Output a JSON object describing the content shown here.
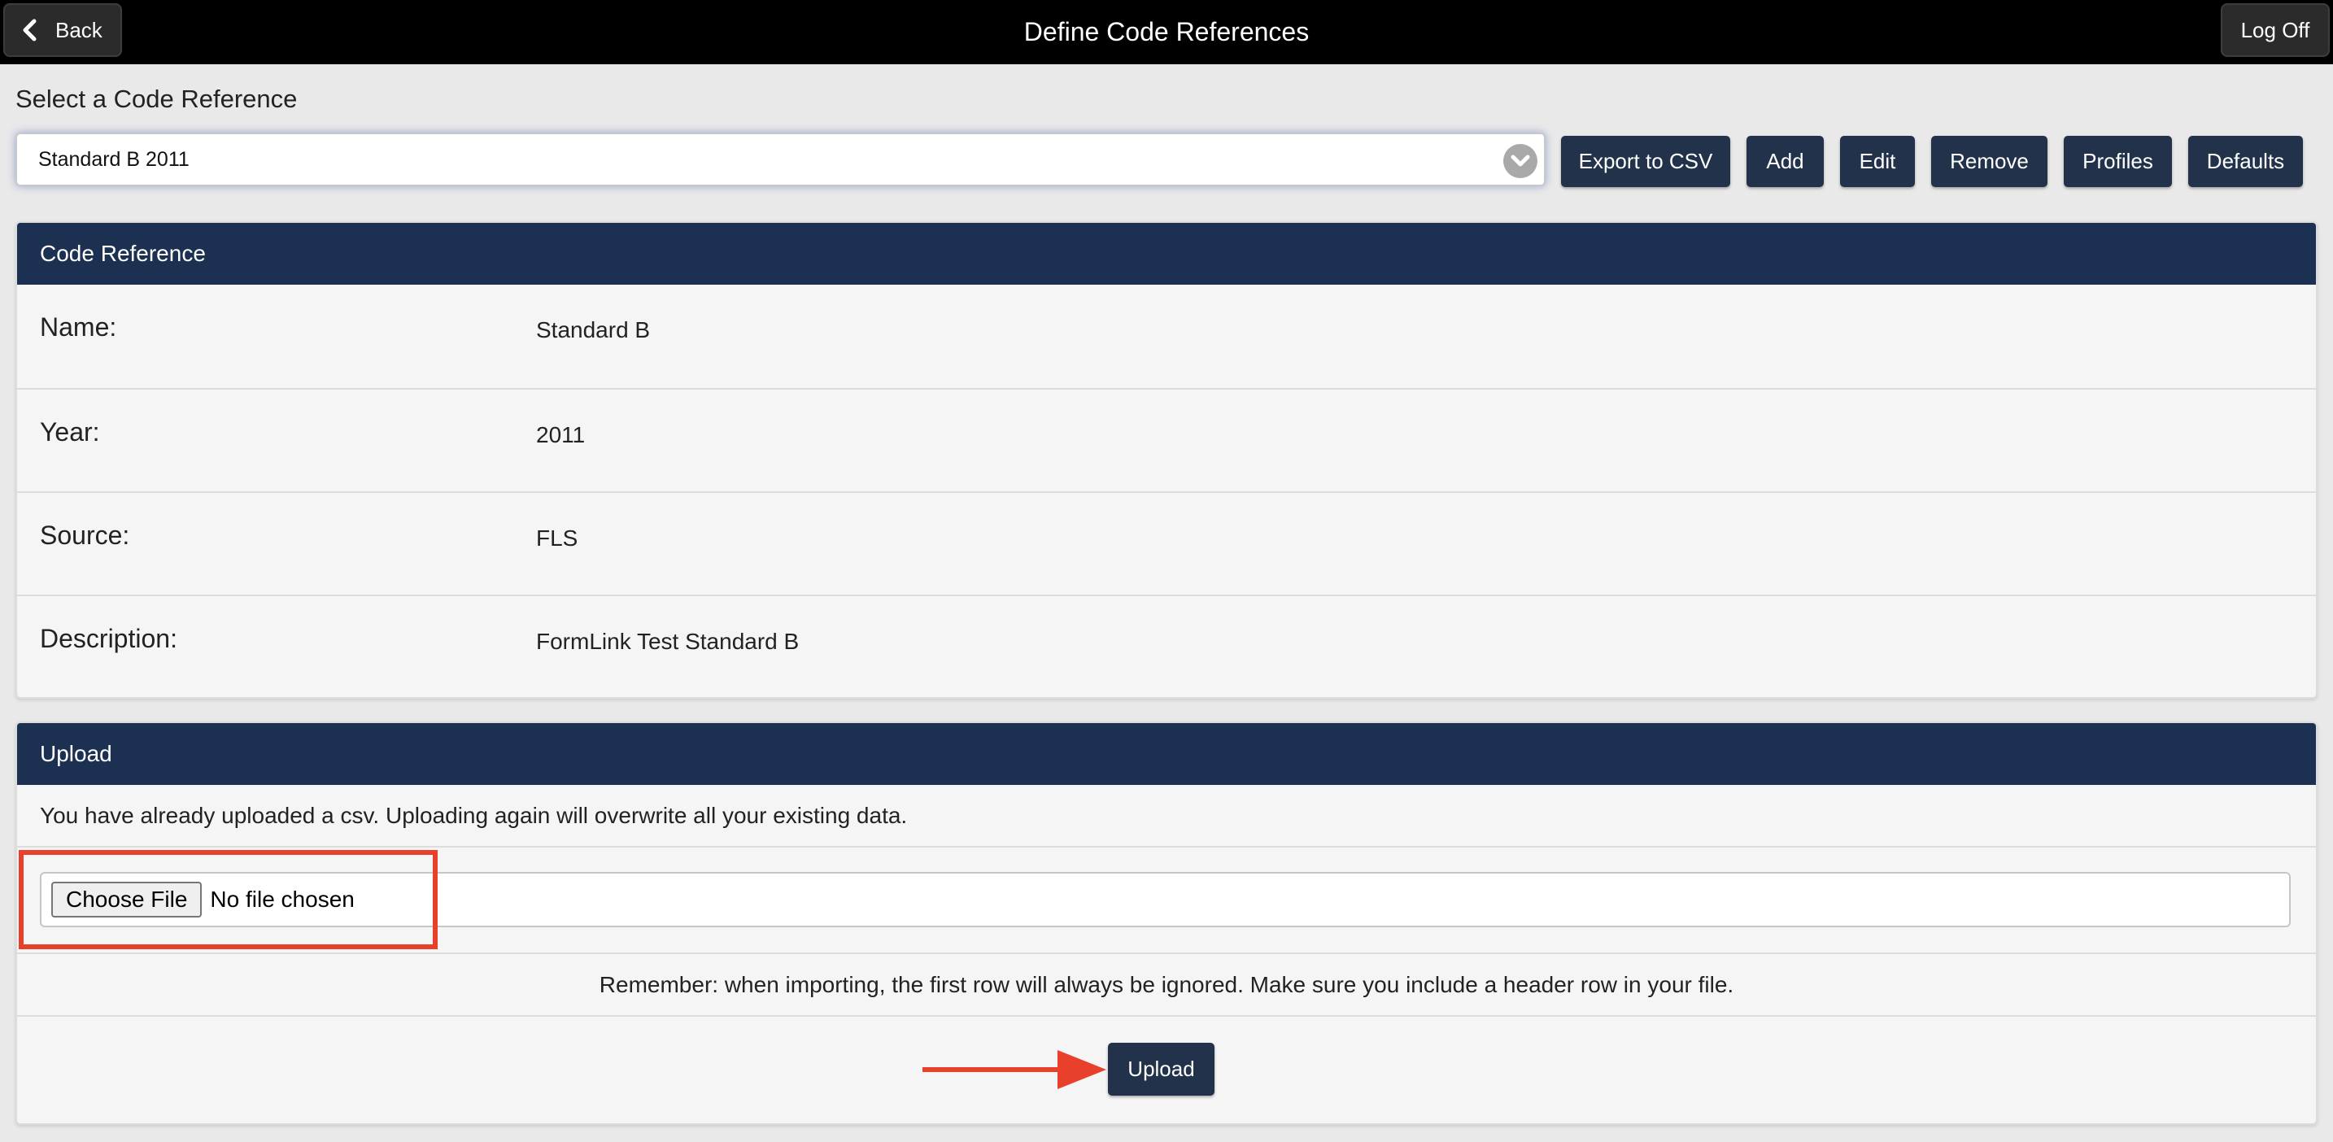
{
  "header": {
    "back_label": "Back",
    "title": "Define Code References",
    "logoff_label": "Log Off"
  },
  "selector": {
    "label": "Select a Code Reference",
    "selected_value": "Standard B 2011"
  },
  "actions": {
    "export_label": "Export to CSV",
    "add_label": "Add",
    "edit_label": "Edit",
    "remove_label": "Remove",
    "profiles_label": "Profiles",
    "defaults_label": "Defaults"
  },
  "code_reference": {
    "heading": "Code Reference",
    "fields": [
      {
        "label": "Name:",
        "value": "Standard B"
      },
      {
        "label": "Year:",
        "value": "2011"
      },
      {
        "label": "Source:",
        "value": "FLS"
      },
      {
        "label": "Description:",
        "value": "FormLink Test Standard B"
      }
    ]
  },
  "upload": {
    "heading": "Upload",
    "note": "You have already uploaded a csv. Uploading again will overwrite all your existing data.",
    "choose_file_label": "Choose File",
    "file_status": "No file chosen",
    "reminder": "Remember: when importing, the first row will always be ignored. Make sure you include a header row in your file.",
    "upload_label": "Upload"
  },
  "colors": {
    "topbar": "#000000",
    "panel_header": "#1c3152",
    "button": "#22324a",
    "annotation": "#e8402a"
  }
}
